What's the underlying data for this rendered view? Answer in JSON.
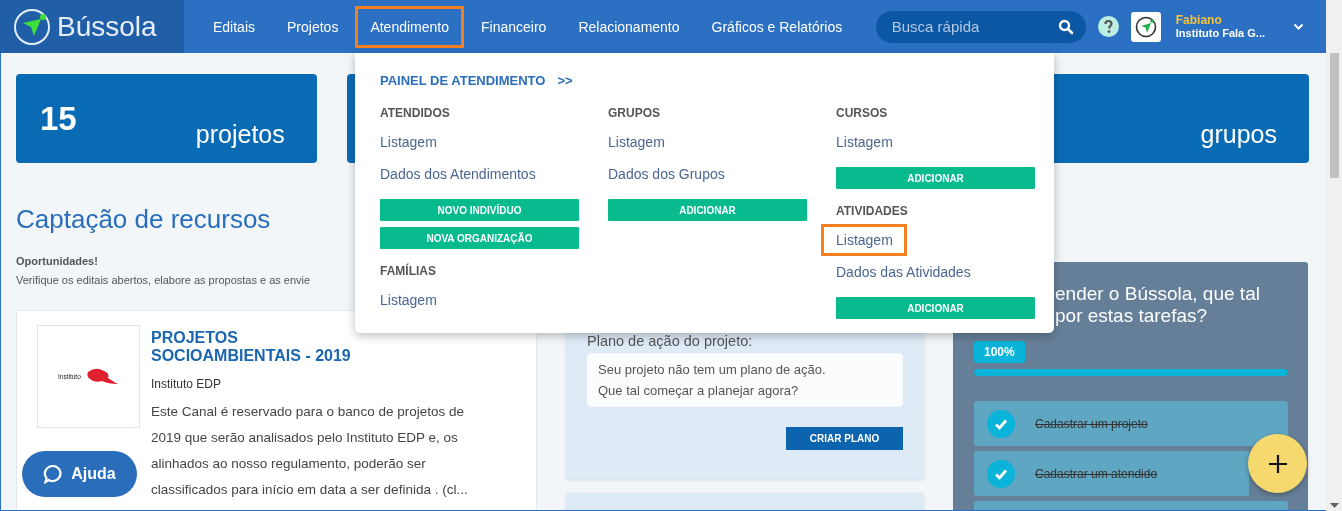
{
  "header": {
    "logo": "Bússola",
    "nav": [
      {
        "label": "Editais",
        "highlighted": false
      },
      {
        "label": "Projetos",
        "highlighted": false
      },
      {
        "label": "Atendimento",
        "highlighted": true
      },
      {
        "label": "Financeiro",
        "highlighted": false
      },
      {
        "label": "Relacionamento",
        "highlighted": false
      },
      {
        "label": "Gráficos e Relatórios",
        "highlighted": false
      }
    ],
    "search": {
      "placeholder": "Busca rápida"
    },
    "user": {
      "name": "Fabiano",
      "organization": "Instituto Fala G..."
    }
  },
  "stats": [
    {
      "kind": "stat",
      "number": "15",
      "label": "projetos"
    },
    {
      "kind": "covered"
    },
    {
      "kind": "stat",
      "label": "grupos"
    }
  ],
  "fundraising": {
    "title": "Captação de recursos",
    "subtitle": "Oportunidades!",
    "description": "Verifique os editais abertos, elabore as propostas e as envie",
    "opportunity": {
      "logo_text": "Instituto",
      "title": "PROJETOS SOCIOAMBIENTAIS - 2019",
      "organization": "Instituto EDP",
      "description": [
        "Este Canal é reservado para o banco de projetos de",
        "2019 que serão analisados pelo Instituto EDP e, os",
        "alinhados ao nosso regulamento, poderão ser",
        "classificados para início em data a ser definida . (cl..."
      ]
    }
  },
  "plan": {
    "label": "Plano de ação do projeto:",
    "message": [
      "Seu projeto não tem um plano de ação.",
      "Que tal começar a planejar agora?"
    ],
    "button": "CRIAR PLANO"
  },
  "onboarding": {
    "title": [
      "ender o Bússola, que tal",
      "por estas tarefas?"
    ],
    "progress": {
      "label": "100%",
      "level": 1
    },
    "tasks": [
      {
        "kind": "task",
        "label": "Cadastrar um projeto",
        "done": true
      },
      {
        "kind": "task",
        "label": "Cadastrar um atendido",
        "done": true
      },
      {
        "kind": "cut"
      }
    ]
  },
  "help_button": {
    "label": "Ajuda"
  },
  "menu": {
    "title": "PAINEL DE ATENDIMENTO",
    "title_arrow": ">>",
    "columns": [
      [
        {
          "heading": "ATENDIDOS",
          "items": [
            {
              "kind": "link",
              "label": "Listagem",
              "highlighted": false
            },
            {
              "kind": "link",
              "label": "Dados dos Atendimentos",
              "highlighted": false
            },
            {
              "kind": "button",
              "label": "NOVO INDIVÍDUO"
            },
            {
              "kind": "button",
              "label": "NOVA ORGANIZAÇÃO"
            }
          ]
        },
        {
          "heading": "FAMÍLIAS",
          "items": [
            {
              "kind": "link",
              "label": "Listagem",
              "highlighted": false
            }
          ]
        }
      ],
      [
        {
          "heading": "GRUPOS",
          "items": [
            {
              "kind": "link",
              "label": "Listagem",
              "highlighted": false
            },
            {
              "kind": "link",
              "label": "Dados dos Grupos",
              "highlighted": false
            },
            {
              "kind": "button",
              "label": "ADICIONAR"
            }
          ]
        }
      ],
      [
        {
          "heading": "CURSOS",
          "items": [
            {
              "kind": "link",
              "label": "Listagem",
              "highlighted": false
            },
            {
              "kind": "button",
              "label": "ADICIONAR"
            }
          ]
        },
        {
          "heading": "ATIVIDADES",
          "items": [
            {
              "kind": "link",
              "label": "Listagem",
              "highlighted": true
            },
            {
              "kind": "link",
              "label": "Dados das Atividades",
              "highlighted": false
            },
            {
              "kind": "button",
              "label": "ADICIONAR"
            }
          ]
        }
      ]
    ]
  }
}
